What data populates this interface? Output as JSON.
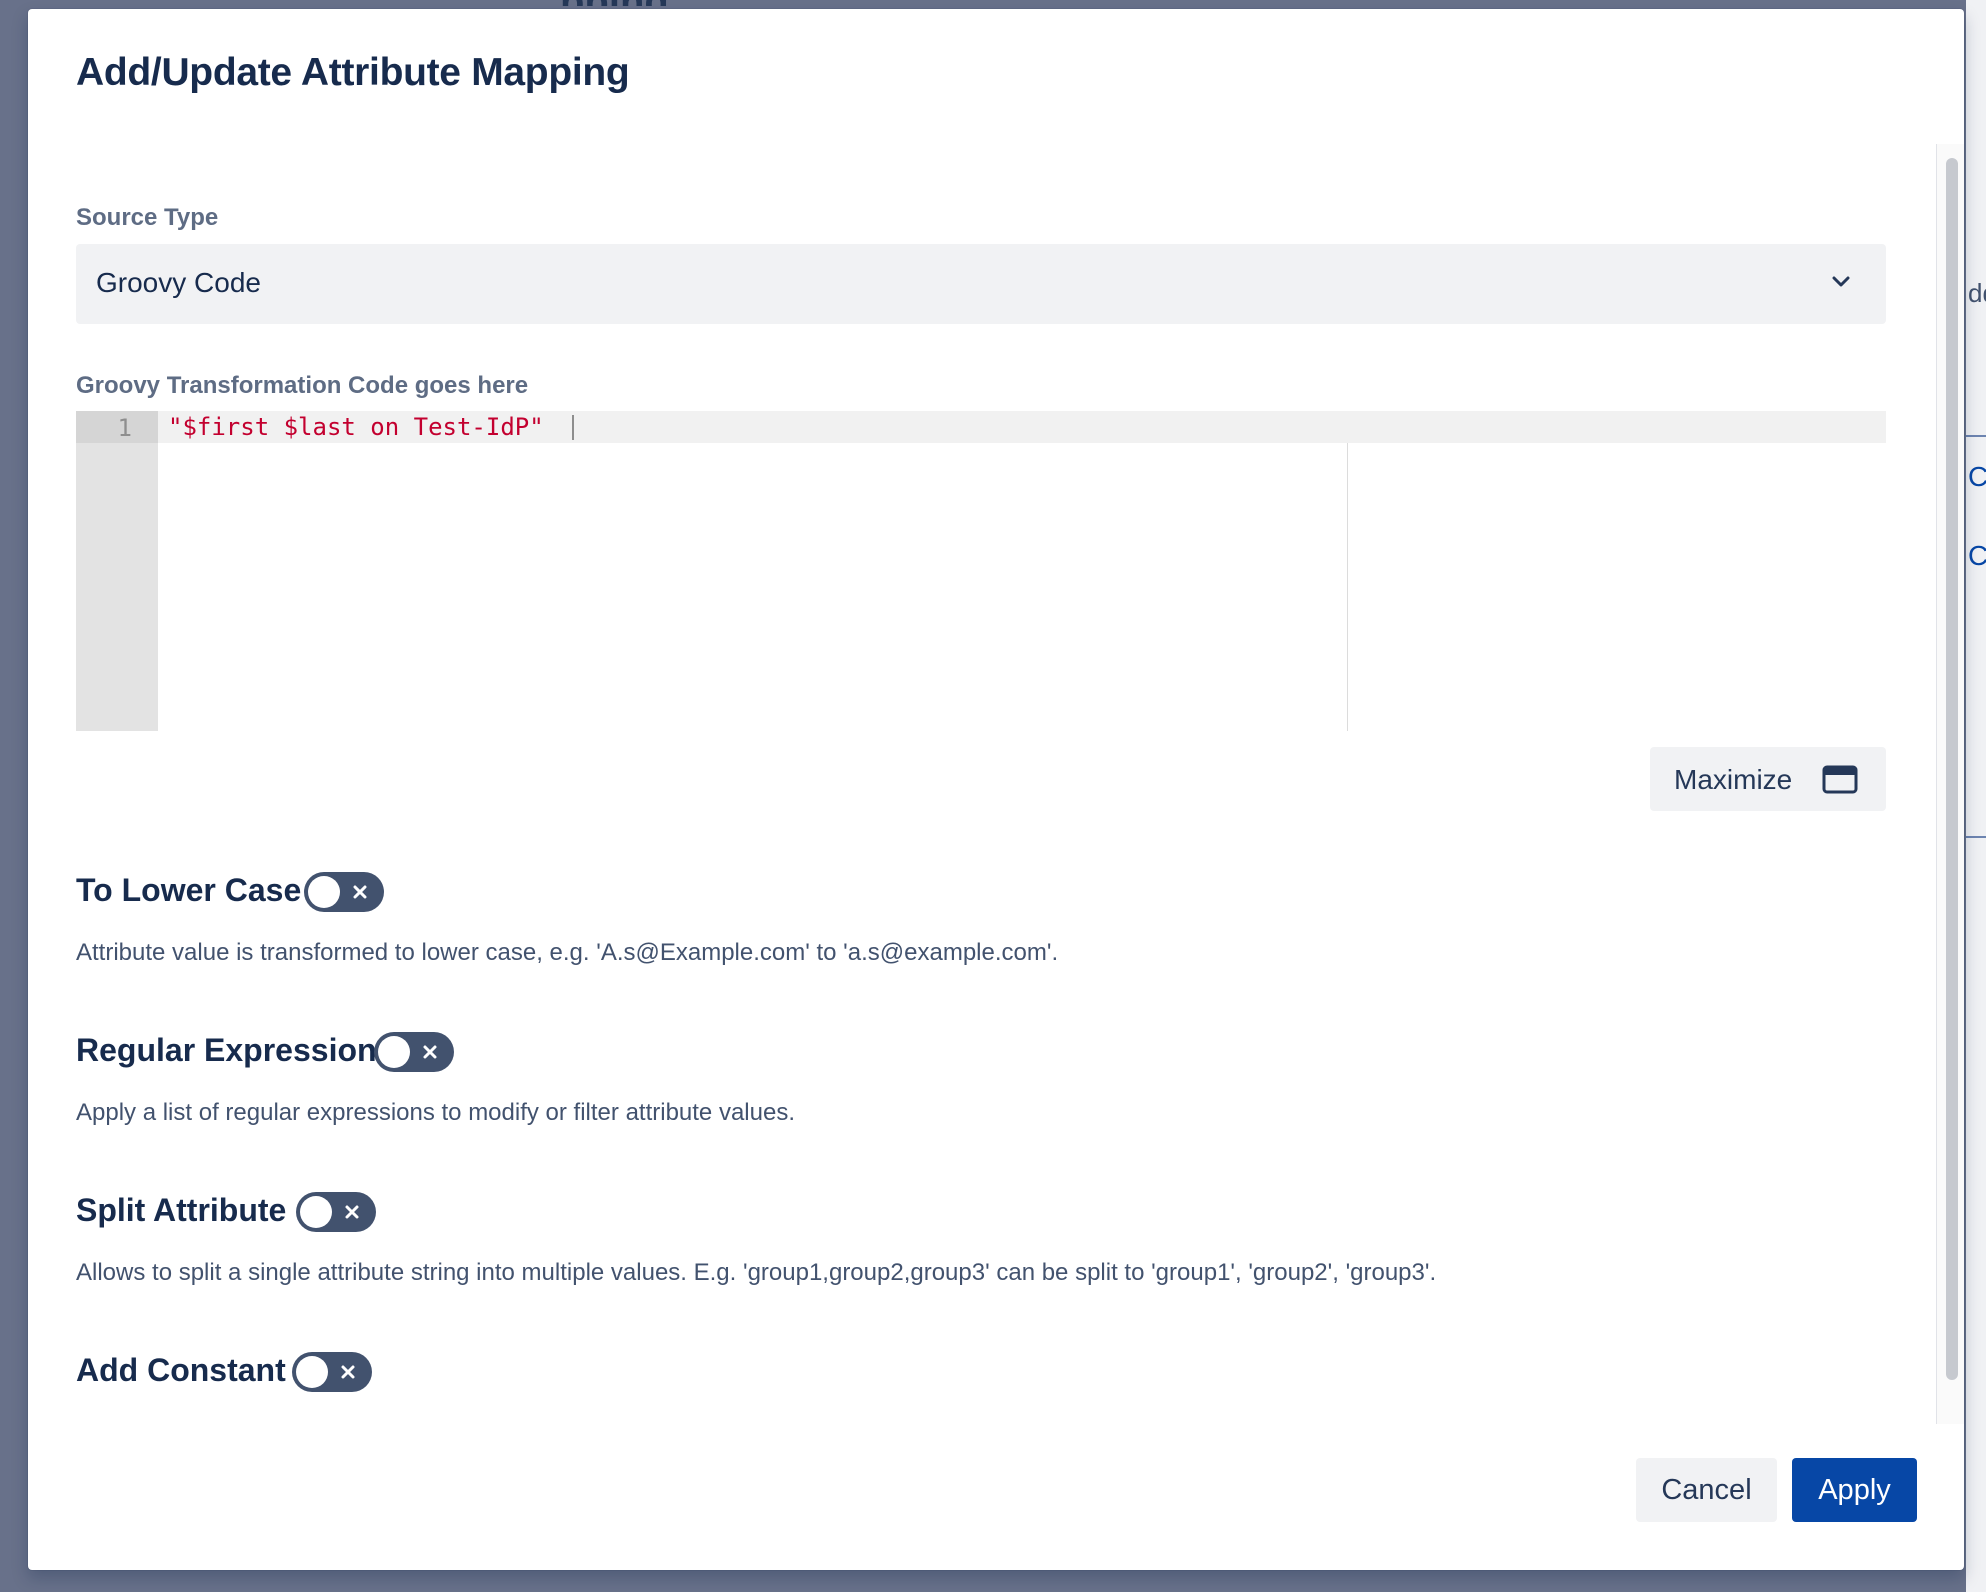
{
  "background": {
    "right_fragments": [
      "dd",
      "C",
      "C"
    ]
  },
  "dialog": {
    "title": "Add/Update Attribute Mapping",
    "source_type": {
      "label": "Source Type",
      "selected": "Groovy Code"
    },
    "code_editor": {
      "label": "Groovy Transformation Code goes here",
      "line_number": "1",
      "code": "\"$first $last on Test-IdP\""
    },
    "maximize_label": "Maximize",
    "options": [
      {
        "title": "To Lower Case",
        "enabled": false,
        "description": "Attribute value is transformed to lower case, e.g. 'A.s@Example.com' to 'a.s@example.com'."
      },
      {
        "title": "Regular Expression",
        "enabled": false,
        "description": "Apply a list of regular expressions to modify or filter attribute values."
      },
      {
        "title": "Split Attribute",
        "enabled": false,
        "description": "Allows to split a single attribute string into multiple values. E.g. 'group1,group2,group3' can be split to 'group1', 'group2', 'group3'."
      },
      {
        "title": "Add Constant",
        "enabled": false
      }
    ],
    "buttons": {
      "cancel": "Cancel",
      "apply": "Apply"
    }
  },
  "colors": {
    "primary": "#0747a6",
    "toggle_off": "#42526e",
    "code_string": "#c3002f",
    "overlay": "#68718a"
  }
}
